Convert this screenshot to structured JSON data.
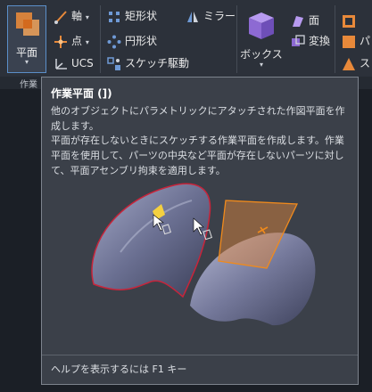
{
  "ribbon": {
    "plane_button_label": "平面",
    "panel_label": "作業",
    "axis_label": "軸",
    "point_label": "点",
    "ucs_label": "UCS",
    "rectangle_label": "矩形状",
    "circle_label": "円形状",
    "sketch_drive_label": "スケッチ駆動",
    "mirror_label": "ミラー",
    "box_label": "ボックス",
    "face_label": "面",
    "transform_label": "変換",
    "right_item_1": "パ",
    "right_item_2": "ス"
  },
  "tooltip": {
    "title": "作業平面 (])",
    "line1": "他のオブジェクトにパラメトリックにアタッチされた作図平面を作成します。",
    "para1": "平面が存在しないときにスケッチする作業平面を作成します。作業平面を使用して、パーツの中央など平面が存在しないパーツに対して、平面アセンブリ拘束を適用します。",
    "footer": "ヘルプを表示するには F1 キー"
  },
  "colors": {
    "accent_blue": "#5b8fc9",
    "plane_orange": "#e8893a",
    "edge_red": "#c8243a",
    "box_purple": "#8d6ad3"
  }
}
